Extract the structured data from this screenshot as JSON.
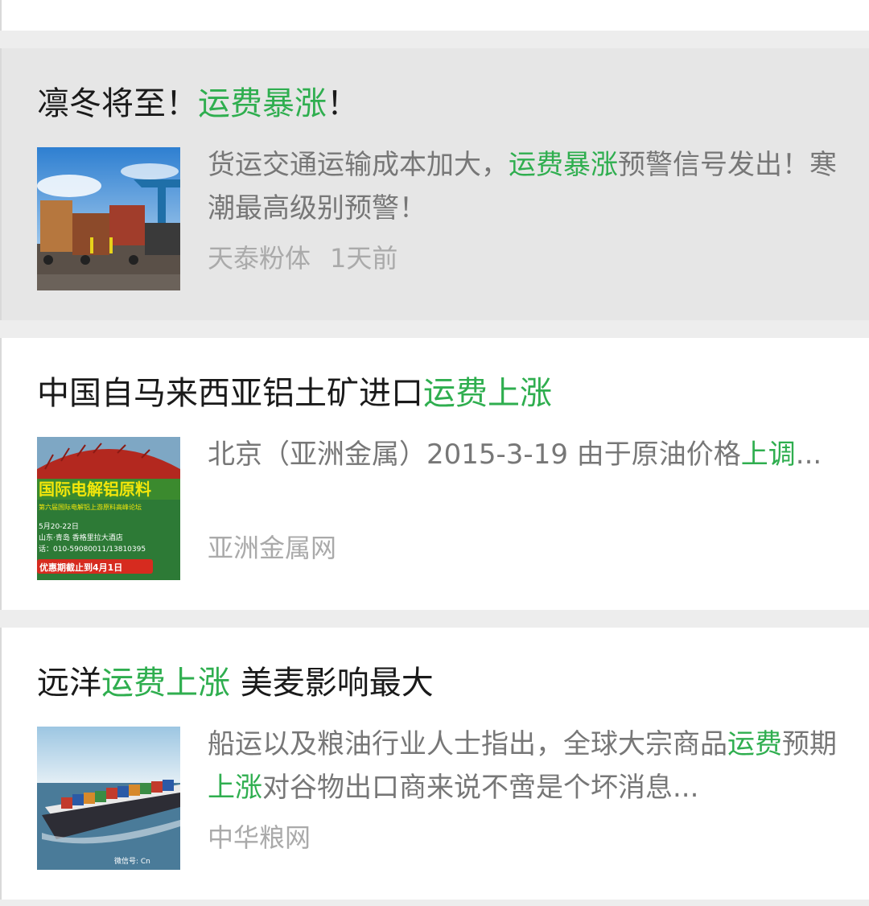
{
  "colors": {
    "highlight": "#2fae4f",
    "title": "#1a1a1a",
    "description": "#777777",
    "source": "#aaaaaa",
    "selected_bg": "#e6e6e6"
  },
  "articles": [
    {
      "title": {
        "before": "凛冬将至！",
        "highlight": "运费暴涨",
        "after": "！"
      },
      "description": {
        "part1": "货运交通运输成本加大，",
        "hl1": "运费暴涨",
        "part2": "预警信号发出！寒潮最高级别预警！",
        "hl2": "",
        "part3": ""
      },
      "source": "天泰粉体",
      "time": "1天前",
      "thumbnail": "container-trucks-port-image"
    },
    {
      "title": {
        "before": "中国自马来西亚铝土矿进口",
        "highlight": "运费上涨",
        "after": ""
      },
      "description": {
        "part1": "北京（亚洲金属）2015-3-19 由于原油价格",
        "hl1": "上调",
        "part2": "...",
        "hl2": "",
        "part3": ""
      },
      "source": "亚洲金属网",
      "time": "",
      "thumbnail": {
        "banner": "国际电解铝原料",
        "subtitle": "第六届国际电解铝上游原料高峰论坛",
        "line1": "5月20-22日",
        "line2": "山东·青岛 香格里拉大酒店",
        "line3": "话：010-59080011/13810395",
        "promo": "优惠期截止到4月1日"
      }
    },
    {
      "title": {
        "before": "远洋",
        "highlight": "运费上涨",
        "after": " 美麦影响最大"
      },
      "description": {
        "part1": "船运以及粮油行业人士指出，全球大宗商品",
        "hl1": "运费",
        "part2": "预期",
        "hl2": "上涨",
        "part3": "对谷物出口商来说不啻是个坏消息..."
      },
      "source": "中华粮网",
      "time": "",
      "thumbnail": {
        "name": "container-ship-image",
        "watermark": "微信号: Cn"
      }
    }
  ]
}
